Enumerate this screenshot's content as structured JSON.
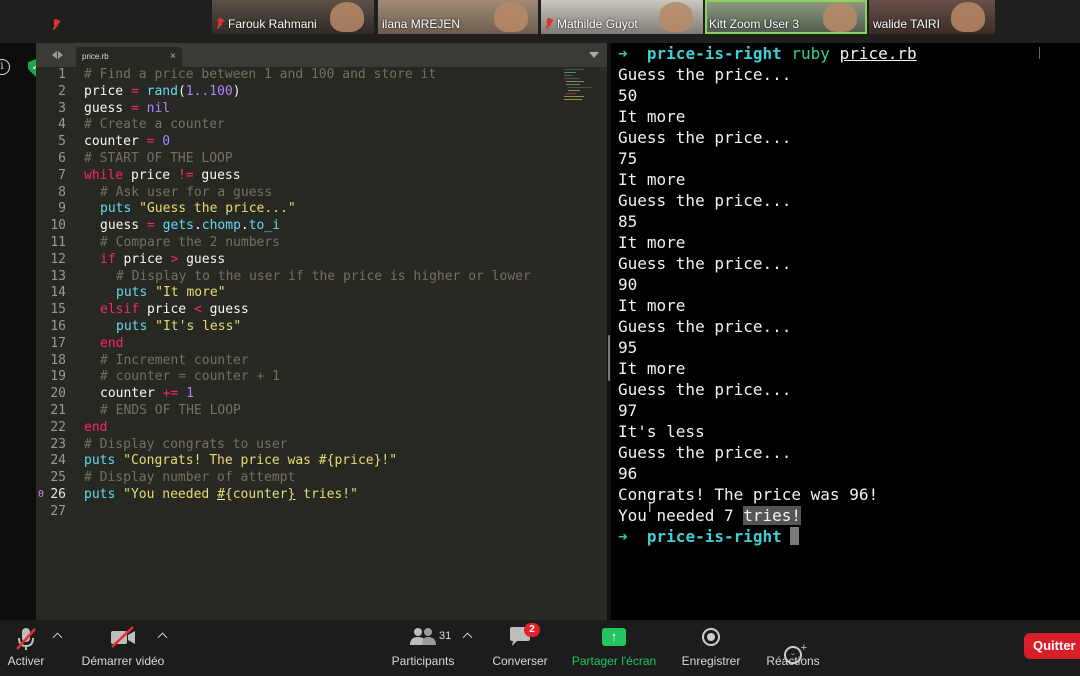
{
  "participants": [
    {
      "name": "",
      "muted": true
    },
    {
      "name": "Farouk Rahmani",
      "muted": true
    },
    {
      "name": "ilana MREJEN",
      "muted": false
    },
    {
      "name": "Mathilde Guyot",
      "muted": true
    },
    {
      "name": "Kitt Zoom User 3",
      "muted": false,
      "active_speaker": true
    },
    {
      "name": "walide TAIRI",
      "muted": false
    }
  ],
  "editor": {
    "tab_title": "price.rb",
    "tab_close": "×",
    "line_numbers": [
      "1",
      "2",
      "3",
      "4",
      "5",
      "6",
      "7",
      "8",
      "9",
      "10",
      "11",
      "12",
      "13",
      "14",
      "15",
      "16",
      "17",
      "18",
      "19",
      "20",
      "21",
      "22",
      "23",
      "24",
      "25",
      "26",
      "27"
    ],
    "bookmark_glyph": "0",
    "code": {
      "l1_comment": "# Find a price between 1 and 100 and store it",
      "l2_var": "price",
      "l2_op": " = ",
      "l2_fn": "rand",
      "l2_open": "(",
      "l2_range": "1..100",
      "l2_close": ")",
      "l3_var": "guess",
      "l3_op": " = ",
      "l3_nil": "nil",
      "l4_comment": "# Create a counter",
      "l5_var": "counter",
      "l5_op": " = ",
      "l5_num": "0",
      "l6_comment": "# START OF THE LOOP",
      "l7_kw": "while",
      "l7_a": " price ",
      "l7_op": "!=",
      "l7_b": " guess",
      "l8_comment": "# Ask user for a guess",
      "l9_fn": "puts",
      "l9_str": " \"Guess the price...\"",
      "l10_var": "guess",
      "l10_op": " = ",
      "l10_fn1": "gets",
      "l10_dot1": ".",
      "l10_fn2": "chomp",
      "l10_dot2": ".",
      "l10_fn3": "to_i",
      "l11_comment": "# Compare the 2 numbers",
      "l12_kw": "if",
      "l12_a": " price ",
      "l12_op": ">",
      "l12_b": " guess",
      "l13_comment": "# Display to the user if the price is higher or lower",
      "l14_fn": "puts",
      "l14_str": " \"It more\"",
      "l15_kw": "elsif",
      "l15_a": " price ",
      "l15_op": "<",
      "l15_b": " guess",
      "l16_fn": "puts",
      "l16_str": " \"It's less\"",
      "l17_kw": "end",
      "l18_comment": "# Increment counter",
      "l19_comment": "# counter = counter + 1",
      "l20_var": "counter",
      "l20_op": " += ",
      "l20_num": "1",
      "l21_comment": "# ENDS OF THE LOOP",
      "l22_kw": "end",
      "l23_comment": "# Display congrats to user",
      "l24_fn": "puts",
      "l24_str": " \"Congrats! The price was #{price}!\"",
      "l25_comment": "# Display number of attempt",
      "l26_fn": "puts",
      "l26_s1": " \"You needed ",
      "l26_hash": "#",
      "l26_brace_open": "{",
      "l26_mid": "counter",
      "l26_brace_close": "}",
      "l26_s2": " tries!\""
    }
  },
  "terminal": {
    "prompt_arrow": "➜",
    "prompt_dir": "price-is-right",
    "command_ruby": "ruby",
    "command_file": "price.rb",
    "output": [
      "Guess the price...",
      "50",
      "It more",
      "Guess the price...",
      "75",
      "It more",
      "Guess the price...",
      "85",
      "It more",
      "Guess the price...",
      "90",
      "It more",
      "Guess the price...",
      "95",
      "It more",
      "Guess the price...",
      "97",
      "It's less",
      "Guess the price...",
      "96",
      "Congrats! The price was 96!"
    ],
    "last_line_a": "You needed 7 ",
    "last_line_sel": "tries!"
  },
  "toolbar": {
    "mute_label": "Activer",
    "video_label": "Démarrer vidéo",
    "participants_label": "Participants",
    "participants_count": "31",
    "chat_label": "Converser",
    "chat_badge": "2",
    "share_label": "Partager l'écran",
    "record_label": "Enregistrer",
    "reactions_label": "Réactions",
    "quit_label": "Quitter"
  },
  "colors": {
    "share_green": "#22c55e",
    "quit_red": "#d81e2a",
    "terminal_green": "#2fd18a",
    "monokai_bg": "#272822"
  }
}
